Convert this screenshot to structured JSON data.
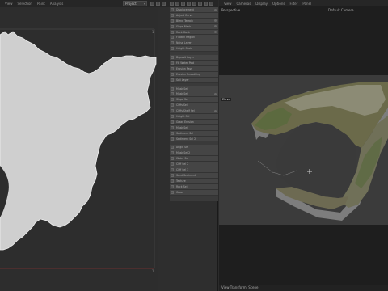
{
  "left_menu": [
    "View",
    "Selection",
    "Paint",
    "Analysis"
  ],
  "project_select": {
    "value": "Project"
  },
  "axis": {
    "top_right": "1",
    "bottom_right": "1"
  },
  "layers_group1": [
    "Displacement",
    "Adjust Curve",
    "Blend Terrain",
    "Slope Mask",
    "Rock Mask",
    "Flatten Region",
    "Noise Layer",
    "Height Scale"
  ],
  "layers_group2": [
    "Deposit Layer",
    "Fill Water Pool",
    "Erosion Pass",
    "Erosion Smoothing",
    "Soil Layer"
  ],
  "layers_group3": [
    "Mask Sel",
    "Mask Sel",
    "Slope Sel",
    "Cliffs Sel",
    "Cliffs Shelf Sel",
    "Height Sel",
    "Grass Erosion",
    "Mask Sel",
    "Sediment Sel",
    "Sediment Sel 2"
  ],
  "layers_group4": [
    "Angle Sel",
    "Mask Sel 2",
    "Water Sel",
    "Cliff Sel 2",
    "Cliff Sel 3",
    "Sand Sediment",
    "Texture",
    "Rock Sel",
    "Grass"
  ],
  "viewport": {
    "menu": [
      "View",
      "Cameras",
      "Display",
      "Options",
      "Filter",
      "Panel"
    ],
    "perspective": "Perspective",
    "camera": "Default Camera",
    "view_tag": "Eleve",
    "status": "View Transform: Scene"
  }
}
